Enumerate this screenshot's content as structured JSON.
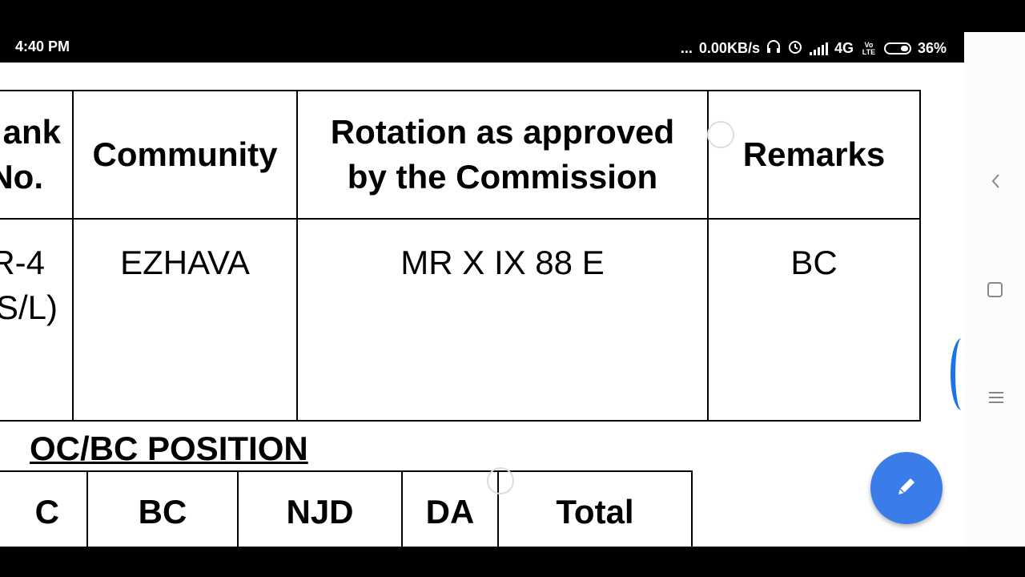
{
  "status_bar": {
    "time": "4:40 PM",
    "dots": "...",
    "speed": "0.00KB/s",
    "network": "4G",
    "volte": "Vo LTE",
    "battery_label": "36%",
    "battery_level": 0.36,
    "icons": [
      "headphones-icon",
      "alarm-icon",
      "signal-icon",
      "battery-icon"
    ]
  },
  "table1": {
    "headers": [
      "ank\nNo.",
      "Community",
      "Rotation as approved by the Commission",
      "Remarks"
    ],
    "row": [
      "R-4\nS/L)",
      "EZHAVA",
      "MR X IX 88 E",
      "BC"
    ]
  },
  "section_title": "OC/BC POSITION",
  "table2": {
    "headers": [
      "C",
      "BC",
      "NJD",
      "DA",
      "Total"
    ]
  },
  "nav": {
    "icons": [
      "back-chevron-icon",
      "square-icon",
      "menu-icon"
    ]
  },
  "fab": {
    "icon": "pencil-icon",
    "color": "#3a7ce8"
  }
}
